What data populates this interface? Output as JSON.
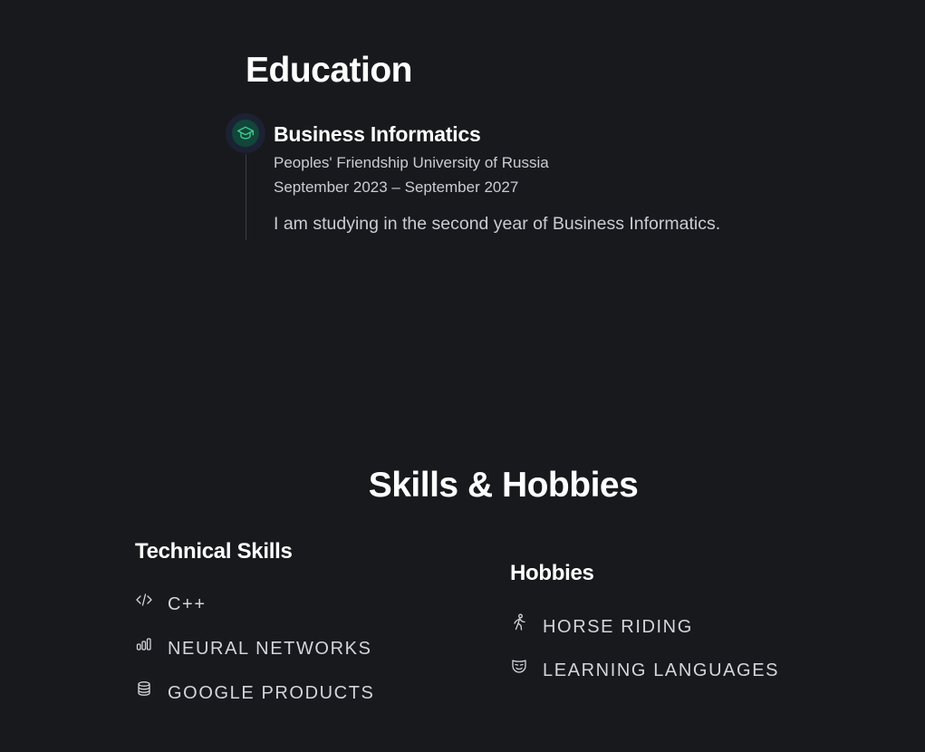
{
  "education": {
    "title": "Education",
    "entry": {
      "icon": "graduation-cap-icon",
      "degree": "Business Informatics",
      "school": "Peoples' Friendship University of Russia",
      "dates": "September 2023 – September 2027",
      "description": "I am studying in the second year of Business Informatics."
    }
  },
  "skills_hobbies": {
    "title": "Skills & Hobbies",
    "technical": {
      "title": "Technical Skills",
      "items": [
        {
          "label": "C++",
          "icon": "code-icon"
        },
        {
          "label": "NEURAL NETWORKS",
          "icon": "bar-chart-icon"
        },
        {
          "label": "GOOGLE PRODUCTS",
          "icon": "database-icon"
        }
      ]
    },
    "hobbies": {
      "title": "Hobbies",
      "items": [
        {
          "label": "HORSE RIDING",
          "icon": "running-person-icon"
        },
        {
          "label": "LEARNING LANGUAGES",
          "icon": "mask-icon"
        }
      ]
    }
  },
  "colors": {
    "background": "#18191d",
    "accent": "#3ecf8e",
    "icon_bg": "#11463a"
  }
}
